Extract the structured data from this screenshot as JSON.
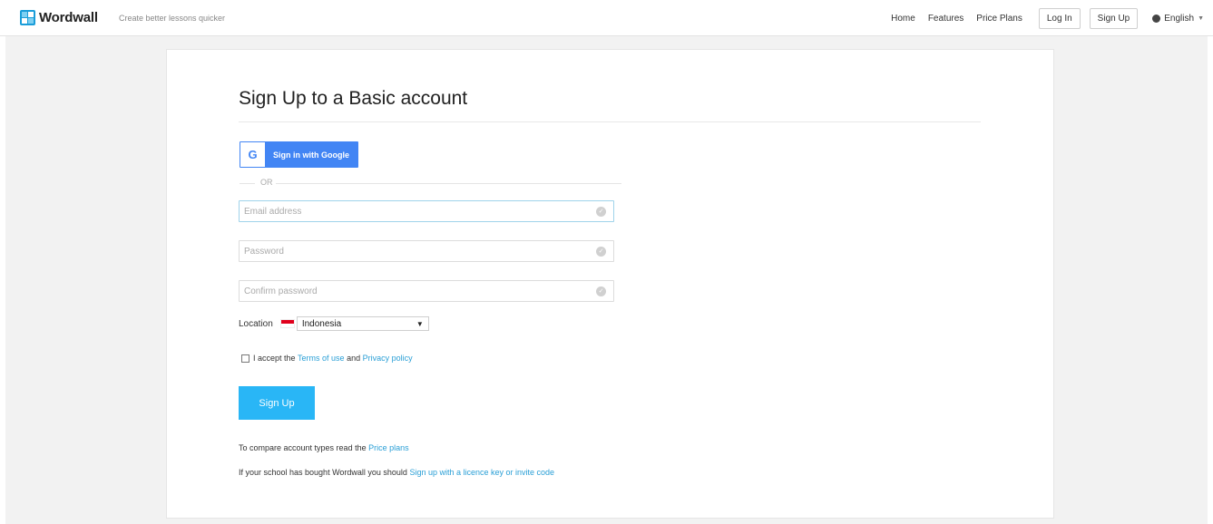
{
  "header": {
    "logo_text": "Wordwall",
    "tagline": "Create better lessons quicker",
    "nav": {
      "home": "Home",
      "features": "Features",
      "price_plans": "Price Plans",
      "login": "Log In",
      "signup": "Sign Up",
      "language": "English"
    }
  },
  "form": {
    "title": "Sign Up to a Basic account",
    "google_button": "Sign in with Google",
    "google_letter": "G",
    "or_text": "OR",
    "email_placeholder": "Email address",
    "password_placeholder": "Password",
    "confirm_placeholder": "Confirm password",
    "location_label": "Location",
    "location_value": "Indonesia",
    "accept_prefix": "I accept the",
    "terms_link": "Terms of use",
    "and_text": "and",
    "privacy_link": "Privacy policy",
    "accept_checked": false,
    "submit_label": "Sign Up",
    "compare_text": "To compare account types read the",
    "compare_link": "Price plans",
    "school_text": "If your school has bought Wordwall you should",
    "school_link": "Sign up with a licence key or invite code"
  },
  "icons": {
    "logo": "wordwall-logo-icon",
    "globe": "globe-icon",
    "google": "google-icon",
    "field_valid": "check-circle-icon",
    "dropdown": "chevron-down-icon"
  },
  "colors": {
    "accent": "#29b6f6",
    "link": "#2a9fd6",
    "google_blue": "#4285f4"
  }
}
